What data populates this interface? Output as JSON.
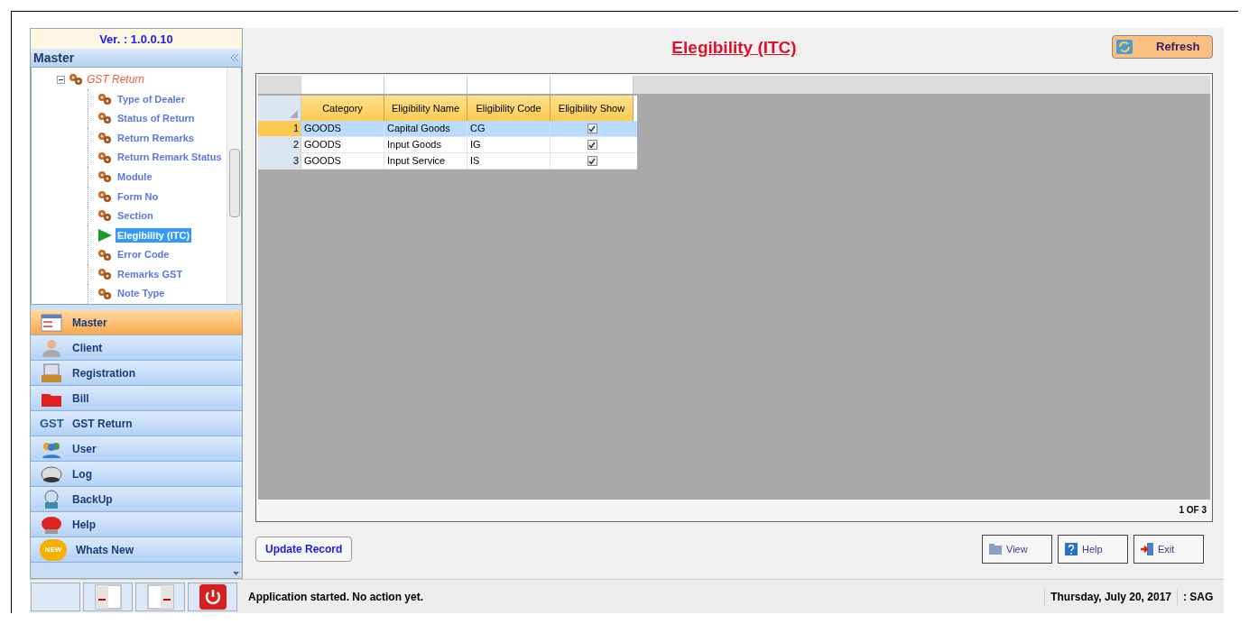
{
  "sidebar": {
    "version": "Ver. : 1.0.0.10",
    "header": "Master",
    "tree": {
      "label": "GST Return",
      "expanded": true,
      "children": [
        {
          "label": "Type of Dealer",
          "selected": false
        },
        {
          "label": "Status of Return",
          "selected": false
        },
        {
          "label": "Return Remarks",
          "selected": false
        },
        {
          "label": "Return Remark Status",
          "selected": false
        },
        {
          "label": "Module",
          "selected": false
        },
        {
          "label": "Form No",
          "selected": false
        },
        {
          "label": "Section",
          "selected": false
        },
        {
          "label": "Elegibility (ITC)",
          "selected": true
        },
        {
          "label": "Error Code",
          "selected": false
        },
        {
          "label": "Remarks GST",
          "selected": false
        },
        {
          "label": "Note Type",
          "selected": false
        }
      ]
    },
    "nav": [
      {
        "label": "Master",
        "selected": true,
        "kind": "table"
      },
      {
        "label": "Client",
        "selected": false,
        "kind": "person"
      },
      {
        "label": "Registration",
        "selected": false,
        "kind": "register"
      },
      {
        "label": "Bill",
        "selected": false,
        "kind": "folder"
      },
      {
        "label": "GST Return",
        "selected": false,
        "kind": "gst",
        "icon_text": "GST"
      },
      {
        "label": "User",
        "selected": false,
        "kind": "users"
      },
      {
        "label": "Log",
        "selected": false,
        "kind": "drive"
      },
      {
        "label": "BackUp",
        "selected": false,
        "kind": "backup"
      },
      {
        "label": "Help",
        "selected": false,
        "kind": "help"
      },
      {
        "label": "Whats New",
        "selected": false,
        "kind": "new",
        "icon_text": "NEW"
      }
    ]
  },
  "main": {
    "title": "Elegibility (ITC)",
    "refresh": "Refresh",
    "table": {
      "columns": [
        "Category",
        "Eligibility Name",
        "Eligibility Code",
        "Eligibility Show"
      ],
      "rows": [
        {
          "index": "1",
          "category": "GOODS",
          "name": "Capital Goods",
          "code": "CG",
          "show": true,
          "selected": true
        },
        {
          "index": "2",
          "category": "GOODS",
          "name": "Input Goods",
          "code": "IG",
          "show": true,
          "selected": false
        },
        {
          "index": "3",
          "category": "GOODS",
          "name": "Input Service",
          "code": "IS",
          "show": true,
          "selected": false
        }
      ]
    },
    "pager": "1 OF 3",
    "update_button": "Update Record",
    "buttons": [
      {
        "label": "View",
        "kind": "view"
      },
      {
        "label": "Help",
        "kind": "help"
      },
      {
        "label": "Exit",
        "kind": "exit"
      }
    ]
  },
  "status_bar": {
    "message": "Application started. No action yet.",
    "date": "Thursday, July 20, 2017",
    "user": ": SAG"
  }
}
